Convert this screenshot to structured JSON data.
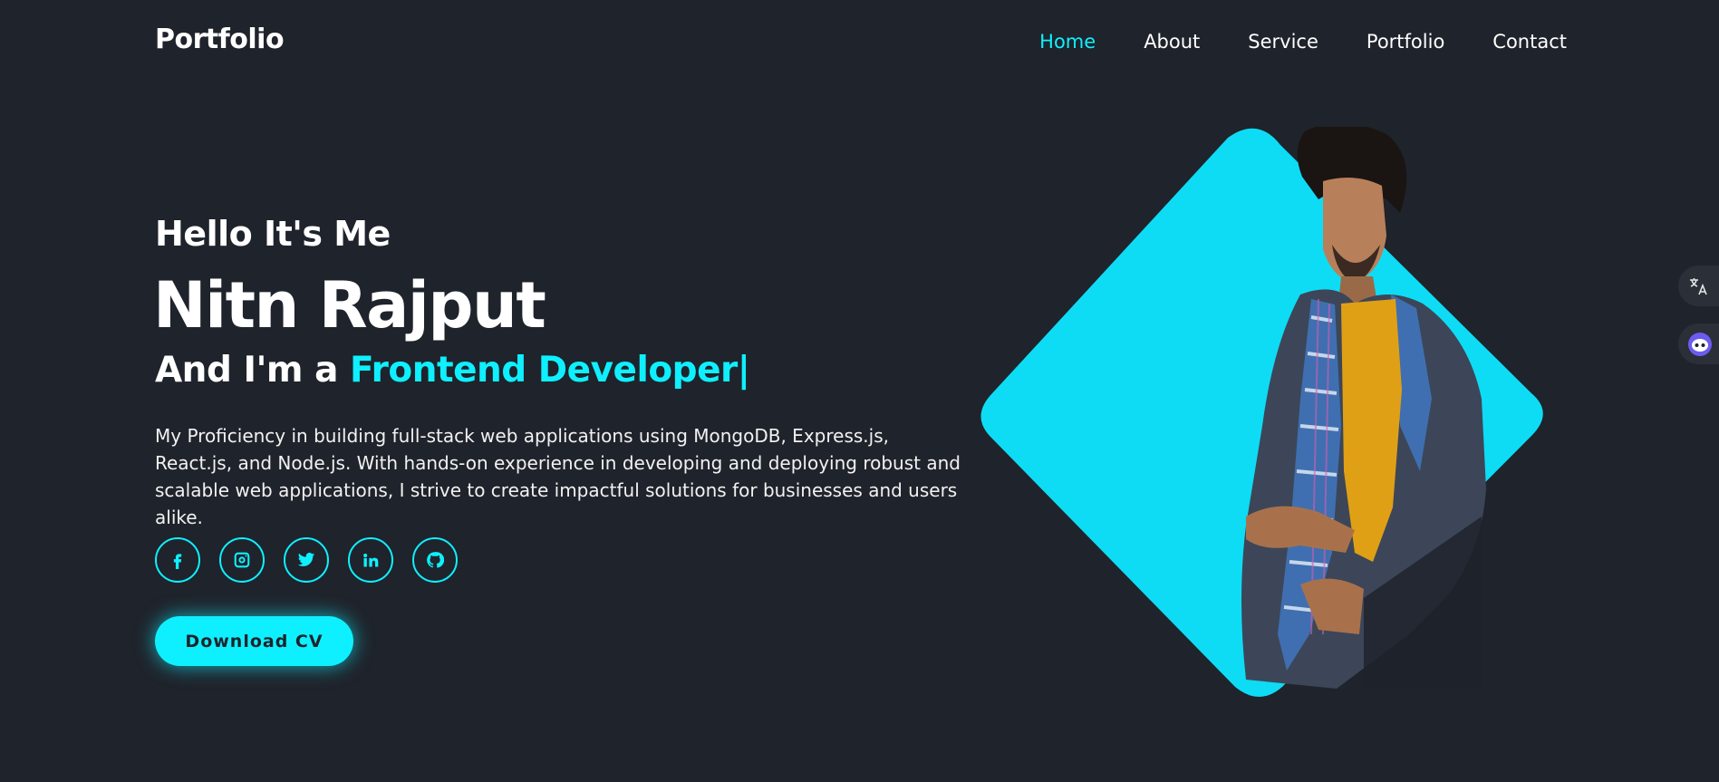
{
  "header": {
    "logo": "Portfolio",
    "nav": [
      {
        "label": "Home",
        "active": true
      },
      {
        "label": "About",
        "active": false
      },
      {
        "label": "Service",
        "active": false
      },
      {
        "label": "Portfolio",
        "active": false
      },
      {
        "label": "Contact",
        "active": false
      }
    ]
  },
  "hero": {
    "greeting": "Hello It's Me",
    "name": "Nitn Rajput",
    "role_prefix": "And I'm a",
    "role_highlight": "Frontend Developer|",
    "bio": "My Proficiency in building full-stack web applications using MongoDB, Express.js, React.js, and Node.js. With hands-on experience in developing and deploying robust and scalable web applications, I strive to create impactful solutions for businesses and users alike.",
    "socials": [
      {
        "icon": "facebook-icon"
      },
      {
        "icon": "instagram-icon"
      },
      {
        "icon": "twitter-icon"
      },
      {
        "icon": "linkedin-icon"
      },
      {
        "icon": "github-icon"
      }
    ],
    "cta_label": "Download CV"
  },
  "colors": {
    "background": "#1f232b",
    "accent": "#0ef0ff",
    "text": "#ffffff"
  },
  "side_widgets": [
    {
      "icon": "translate-icon"
    },
    {
      "icon": "assistant-icon"
    }
  ]
}
